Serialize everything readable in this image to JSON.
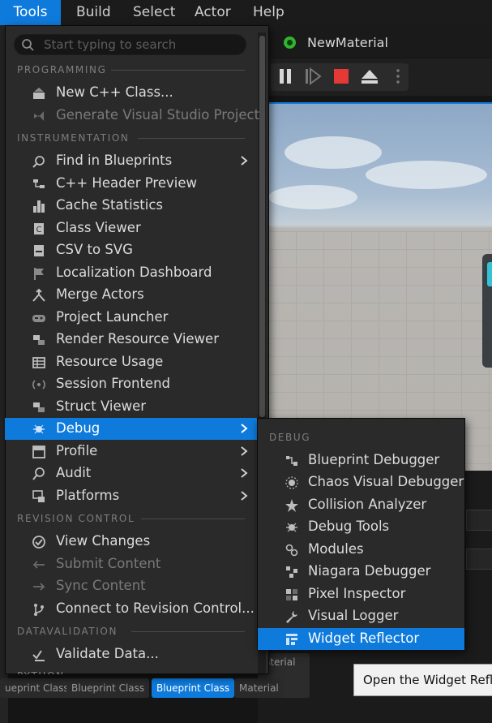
{
  "menubar": {
    "items": [
      {
        "label": "Tools",
        "active": true
      },
      {
        "label": "Build"
      },
      {
        "label": "Select"
      },
      {
        "label": "Actor"
      },
      {
        "label": "Help"
      }
    ]
  },
  "editor": {
    "tab_label": "NewMaterial",
    "thumb_labels": [
      "ueprint Class",
      "Blueprint Class",
      "Blueprint Class",
      "Material"
    ],
    "tile_label": "aterial"
  },
  "tools_menu": {
    "search_placeholder": "Start typing to search",
    "sections": {
      "programming": "PROGRAMMING",
      "instrumentation": "INSTRUMENTATION",
      "revision_control": "REVISION CONTROL",
      "datavalidation": "DATAVALIDATION",
      "python": "PYTHON"
    },
    "programming_items": [
      {
        "label": "New C++ Class...",
        "icon": "cpp-class-icon"
      },
      {
        "label": "Generate Visual Studio Project",
        "icon": "visual-studio-icon",
        "disabled": true
      }
    ],
    "instrumentation_items": [
      {
        "label": "Find in Blueprints",
        "icon": "find-blueprints-icon",
        "submenu": true
      },
      {
        "label": "C++ Header Preview",
        "icon": "header-preview-icon"
      },
      {
        "label": "Cache Statistics",
        "icon": "bar-chart-icon"
      },
      {
        "label": "Class Viewer",
        "icon": "class-viewer-icon"
      },
      {
        "label": "CSV to SVG",
        "icon": "csv-svg-icon"
      },
      {
        "label": "Localization Dashboard",
        "icon": "flag-icon"
      },
      {
        "label": "Merge Actors",
        "icon": "merge-icon"
      },
      {
        "label": "Project Launcher",
        "icon": "gamepad-icon"
      },
      {
        "label": "Render Resource Viewer",
        "icon": "resource-viewer-icon"
      },
      {
        "label": "Resource Usage",
        "icon": "table-icon"
      },
      {
        "label": "Session Frontend",
        "icon": "broadcast-icon"
      },
      {
        "label": "Struct Viewer",
        "icon": "struct-viewer-icon"
      },
      {
        "label": "Debug",
        "icon": "bug-icon",
        "submenu": true,
        "highlight": true
      },
      {
        "label": "Profile",
        "icon": "profile-icon",
        "submenu": true
      },
      {
        "label": "Audit",
        "icon": "audit-icon",
        "submenu": true
      },
      {
        "label": "Platforms",
        "icon": "platforms-icon",
        "submenu": true
      }
    ],
    "revision_items": [
      {
        "label": "View Changes",
        "icon": "check-circle-icon"
      },
      {
        "label": "Submit Content",
        "icon": "arrow-left-icon",
        "disabled": true
      },
      {
        "label": "Sync Content",
        "icon": "arrow-right-icon",
        "disabled": true
      },
      {
        "label": "Connect to Revision Control...",
        "icon": "branch-icon"
      }
    ],
    "datavalidation_items": [
      {
        "label": "Validate Data...",
        "icon": "validate-icon"
      }
    ]
  },
  "debug_submenu": {
    "section": "DEBUG",
    "items": [
      {
        "label": "Blueprint Debugger",
        "icon": "blueprint-debugger-icon"
      },
      {
        "label": "Chaos Visual Debugger",
        "icon": "chaos-icon"
      },
      {
        "label": "Collision Analyzer",
        "icon": "collision-icon"
      },
      {
        "label": "Debug Tools",
        "icon": "debug-tools-icon"
      },
      {
        "label": "Modules",
        "icon": "modules-icon"
      },
      {
        "label": "Niagara Debugger",
        "icon": "niagara-icon"
      },
      {
        "label": "Pixel Inspector",
        "icon": "pixel-inspector-icon"
      },
      {
        "label": "Visual Logger",
        "icon": "wrench-icon"
      },
      {
        "label": "Widget Reflector",
        "icon": "widget-reflector-icon",
        "highlight": true
      }
    ]
  },
  "tooltip": {
    "text": "Open the Widget Reflec"
  },
  "colors": {
    "accent": "#0e7bdc",
    "menu_bg": "#2a2a2a",
    "stop_red": "#e53935"
  }
}
